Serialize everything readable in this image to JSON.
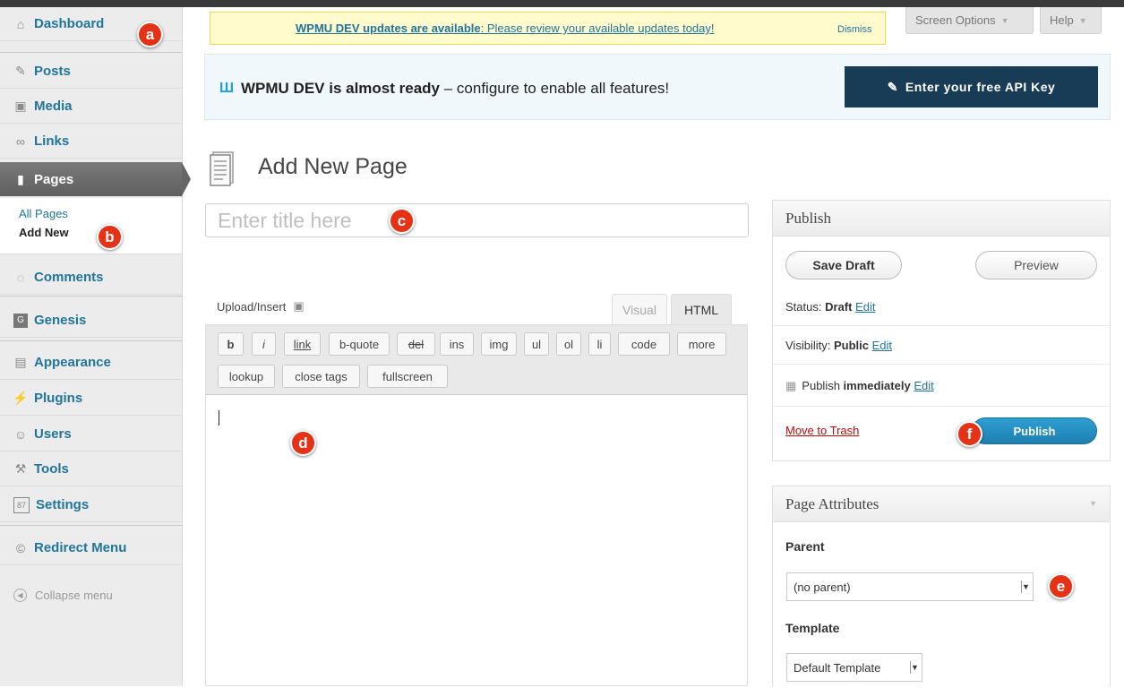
{
  "sidebar": {
    "items": [
      {
        "label": "Dashboard",
        "icon": "home-icon"
      },
      {
        "label": "Posts",
        "icon": "pin-icon"
      },
      {
        "label": "Media",
        "icon": "media-icon"
      },
      {
        "label": "Links",
        "icon": "link-icon"
      },
      {
        "label": "Pages",
        "icon": "pages-icon"
      },
      {
        "label": "Comments",
        "icon": "comment-icon"
      },
      {
        "label": "Genesis",
        "icon": "genesis-icon"
      },
      {
        "label": "Appearance",
        "icon": "appearance-icon"
      },
      {
        "label": "Plugins",
        "icon": "plugin-icon"
      },
      {
        "label": "Users",
        "icon": "users-icon"
      },
      {
        "label": "Tools",
        "icon": "tools-icon"
      },
      {
        "label": "Settings",
        "icon": "settings-icon"
      },
      {
        "label": "Redirect Menu",
        "icon": "redirect-icon"
      }
    ],
    "submenu": {
      "all_pages": "All Pages",
      "add_new": "Add New"
    },
    "collapse": "Collapse menu"
  },
  "badges": {
    "a": "a",
    "b": "b",
    "c": "c",
    "d": "d",
    "e": "e",
    "f": "f"
  },
  "notice": {
    "bold": "WPMU DEV updates are available",
    "rest": ": Please review your available updates today!",
    "dismiss": "Dismiss"
  },
  "screen_options": "Screen Options",
  "help": "Help",
  "devbanner": {
    "logo": "Ш",
    "bold": "WPMU DEV is almost ready",
    "rest": " – configure to enable all features!",
    "api_button": "Enter your free API Key"
  },
  "page_title": "Add New Page",
  "title_placeholder": "Enter title here",
  "editor": {
    "upload_insert": "Upload/Insert",
    "tab_visual": "Visual",
    "tab_html": "HTML",
    "buttons_row1": [
      "b",
      "i",
      "link",
      "b-quote",
      "del",
      "ins",
      "img",
      "ul",
      "ol",
      "li",
      "code",
      "more"
    ],
    "buttons_row2": [
      "lookup",
      "close tags",
      "fullscreen"
    ]
  },
  "publish": {
    "title": "Publish",
    "save_draft": "Save Draft",
    "preview": "Preview",
    "status_label": "Status: ",
    "status_value": "Draft",
    "visibility_label": "Visibility: ",
    "visibility_value": "Public",
    "publish_label": "Publish ",
    "publish_value": "immediately",
    "edit": "Edit",
    "move_to_trash": "Move to Trash",
    "publish_button": "Publish"
  },
  "page_attributes": {
    "title": "Page Attributes",
    "parent_label": "Parent",
    "parent_value": "(no parent)",
    "template_label": "Template",
    "template_value": "Default Template"
  },
  "colors": {
    "accent": "#21759b",
    "badge": "#e53116",
    "api_button": "#183b56",
    "publish_button": "#2e9fd2"
  }
}
